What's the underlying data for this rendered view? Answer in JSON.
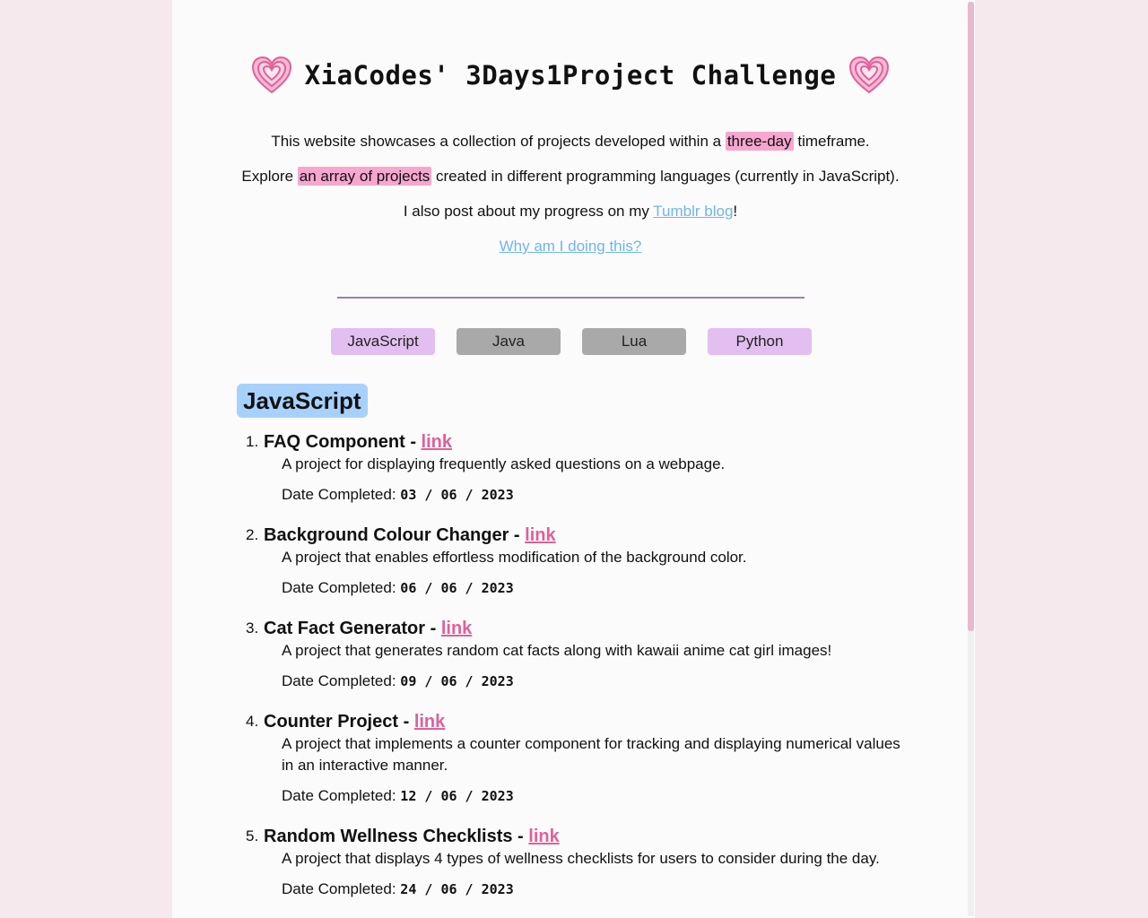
{
  "header": {
    "title": "XiaCodes' 3Days1Project Challenge",
    "left_icon": "pink-heart-icon",
    "right_icon": "pink-heart-icon"
  },
  "intro": {
    "line1_before": "This website showcases a collection of projects developed within a ",
    "line1_highlight": "three-day",
    "line1_after": " timeframe.",
    "line2_before": "Explore ",
    "line2_highlight": "an array of projects",
    "line2_after": " created in different programming languages (currently in JavaScript).",
    "line3_before": "I also post about my progress on my ",
    "line3_link": "Tumblr blog",
    "line3_after": "!",
    "why_link": "Why am I doing this?"
  },
  "tabs": [
    {
      "label": "JavaScript",
      "state": "active"
    },
    {
      "label": "Java",
      "state": "inactive"
    },
    {
      "label": "Lua",
      "state": "inactive"
    },
    {
      "label": "Python",
      "state": "active"
    }
  ],
  "section": {
    "heading": "JavaScript",
    "date_label": "Date Completed: ",
    "separator": " - ",
    "link_label": "link",
    "projects": [
      {
        "num": "1.",
        "title": "FAQ Component",
        "desc": "A project for displaying frequently asked questions on a webpage.",
        "date": "03 / 06 / 2023"
      },
      {
        "num": "2.",
        "title": "Background Colour Changer",
        "desc": "A project that enables effortless modification of the background color.",
        "date": "06 / 06 / 2023"
      },
      {
        "num": "3.",
        "title": "Cat Fact Generator",
        "desc": "A project that generates random cat facts along with kawaii anime cat girl images!",
        "date": "09 / 06 / 2023"
      },
      {
        "num": "4.",
        "title": "Counter Project",
        "desc": "A project that implements a counter component for tracking and displaying numerical values in an interactive manner.",
        "date": "12 / 06 / 2023"
      },
      {
        "num": "5.",
        "title": "Random Wellness Checklists",
        "desc": "A project that displays 4 types of wellness checklists for users to consider during the day.",
        "date": "24 / 06 / 2023"
      }
    ]
  },
  "colors": {
    "background": "#f6e9ee",
    "page": "#fbfbfb",
    "highlight": "#f7a6cf",
    "blue_link": "#6fb6ea",
    "pink_link": "#e0609a",
    "tab_active": "#e2bff0",
    "tab_inactive": "#a9a9a9",
    "heading_bg": "#a7d1fb",
    "divider": "#a17ca8"
  }
}
